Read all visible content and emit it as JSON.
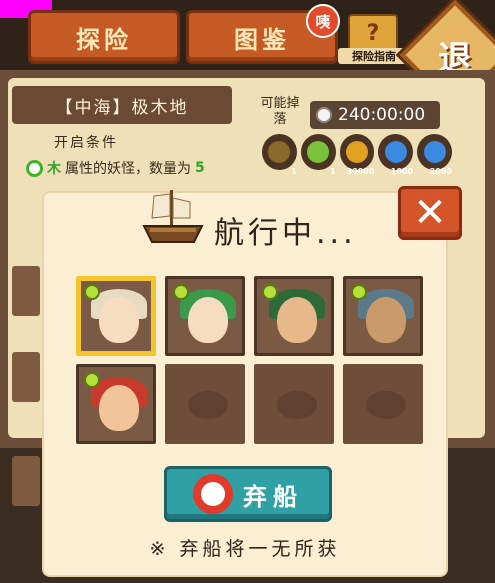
{
  "top_tabs": {
    "explore": "探险",
    "atlas": "图鉴"
  },
  "badge": "咦",
  "guide_label": "探险指南",
  "retreat": "退",
  "stage": {
    "title": "【中海】极木地",
    "drop_label": "可能掉落",
    "timer": "240:00:00",
    "conditions_label": "开启条件",
    "condition": {
      "element": "木",
      "text": "属性的妖怪，数量为",
      "count": "5"
    }
  },
  "drops": [
    {
      "icon": "wood-token-icon",
      "qty": "1"
    },
    {
      "icon": "green-orb-icon",
      "qty": "1"
    },
    {
      "icon": "gold-pot-icon",
      "qty": "30000"
    },
    {
      "icon": "blue-flame-icon",
      "qty": "1000"
    },
    {
      "icon": "blue-flame-icon",
      "qty": "2000"
    }
  ],
  "modal": {
    "title": "航行中...",
    "abandon_label": "弃船",
    "warning": "※ 弃船将一无所获"
  },
  "party_slots": [
    {
      "state": "filled",
      "selected": true,
      "element": "wood",
      "hair": "#e7dcc3",
      "skin": "#f6dcc0"
    },
    {
      "state": "filled",
      "selected": false,
      "element": "wood",
      "hair": "#3a9a4a",
      "skin": "#f6dcc0"
    },
    {
      "state": "filled",
      "selected": false,
      "element": "wood",
      "hair": "#2e6a38",
      "skin": "#e7b98a"
    },
    {
      "state": "filled",
      "selected": false,
      "element": "wood",
      "hair": "#5a7a8a",
      "skin": "#c99a6a"
    },
    {
      "state": "filled",
      "selected": false,
      "element": "wood",
      "hair": "#c83a2a",
      "skin": "#f2c49a"
    },
    {
      "state": "empty"
    },
    {
      "state": "empty"
    },
    {
      "state": "empty"
    }
  ],
  "colors": {
    "accent_orange": "#c55a24",
    "teal_button": "#2fa0a4",
    "element_green": "#2fa52a"
  }
}
